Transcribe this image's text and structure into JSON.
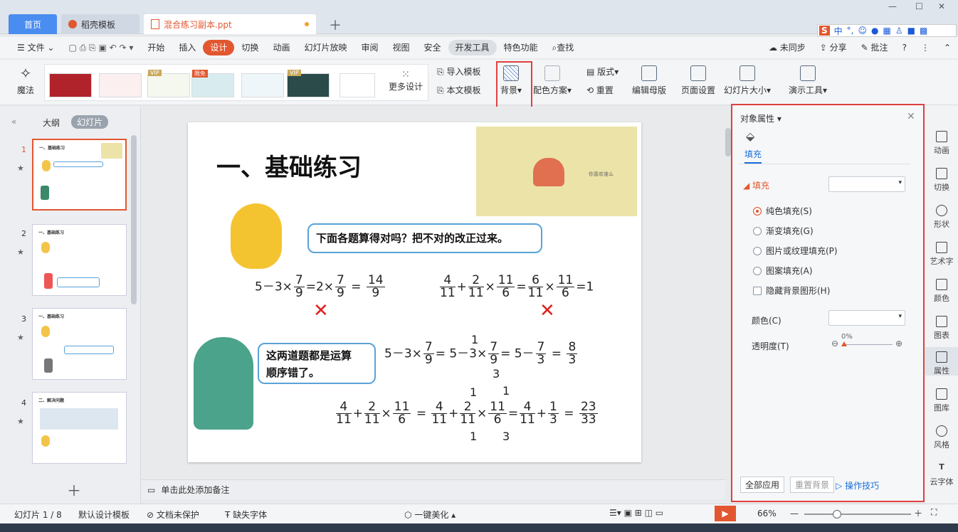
{
  "tabs": {
    "home": "首页",
    "template": "稻壳模板",
    "document": "混合练习副本.ppt"
  },
  "menu": [
    "文件",
    "开始",
    "插入",
    "设计",
    "切换",
    "动画",
    "幻灯片放映",
    "审阅",
    "视图",
    "安全",
    "开发工具",
    "特色功能",
    "查找"
  ],
  "menu_right": {
    "sync": "未同步",
    "share": "分享",
    "comment": "批注"
  },
  "ime": {
    "lang": "中"
  },
  "ribbon": {
    "magic": "魔法",
    "more_design": "更多设计",
    "import_template": "导入模板",
    "this_template": "本文模板",
    "background": "背景",
    "color_scheme": "配色方案",
    "layout": "版式",
    "reset": "重置",
    "edit_master": "编辑母版",
    "page_setup": "页面设置",
    "slide_size": "幻灯片大小",
    "presentation_tools": "演示工具"
  },
  "left_pane": {
    "outline": "大纲",
    "slides": "幻灯片",
    "numbers": [
      "1",
      "2",
      "3",
      "4"
    ],
    "thumb_titles": [
      "一、基础练习",
      "一、基础练习",
      "一、基础练习",
      "二、解决问题"
    ]
  },
  "slide": {
    "title": "一、基础练习",
    "image_caption": "你喜欢谁么",
    "bubble1": "下面各题算得对吗？把不对的改正过来。",
    "bubble2a": "这两道题都是运算",
    "bubble2b": "顺序错了。",
    "eq1": {
      "a": "5－3×",
      "f1n": "7",
      "f1d": "9",
      "b": "=2×",
      "f2n": "7",
      "f2d": "9",
      "c": "=",
      "f3n": "14",
      "f3d": "9"
    },
    "eq2": {
      "f1n": "4",
      "f1d": "11",
      "p": "+",
      "f2n": "2",
      "f2d": "11",
      "x": "×",
      "f3n": "11",
      "f3d": "6",
      "e": "=",
      "f4n": "6",
      "f4d": "11",
      "x2": "×",
      "f5n": "11",
      "f5d": "6",
      "r": "=1"
    },
    "eq3": {
      "a": "5－3×",
      "f1n": "7",
      "f1d": "9",
      "b": "= 5－3×",
      "f2n": "7",
      "f2d": "9",
      "c": "= 5－",
      "f3n": "7",
      "f3d": "3",
      "e": "=",
      "f4n": "8",
      "f4d": "3",
      "up": "1",
      "down": "3"
    },
    "eq4": {
      "f1n": "4",
      "f1d": "11",
      "p": "+",
      "f2n": "2",
      "f2d": "11",
      "x": "×",
      "f3n": "11",
      "f3d": "6",
      "e": "=",
      "f4n": "4",
      "f4d": "11",
      "p2": "+",
      "f5n": "2",
      "f5d": "11",
      "x2": "×",
      "f6n": "11",
      "f6d": "6",
      "e2": "=",
      "f7n": "4",
      "f7d": "11",
      "p3": "+",
      "f8n": "1",
      "f8d": "3",
      "e3": "=",
      "f9n": "23",
      "f9d": "33",
      "c1": "1",
      "c2": "1",
      "c3": "1",
      "c4": "3"
    }
  },
  "notes_placeholder": "单击此处添加备注",
  "panel": {
    "title": "对象属性",
    "fill_tab": "填充",
    "fill_section": "填充",
    "options": [
      "纯色填充(S)",
      "渐变填充(G)",
      "图片或纹理填充(P)",
      "图案填充(A)"
    ],
    "hide_bg": "隐藏背景图形(H)",
    "color_label": "颜色(C)",
    "transparency_label": "透明度(T)",
    "transparency_value": "0%",
    "apply_all": "全部应用",
    "reset_bg": "重置背景",
    "tips": "操作技巧"
  },
  "sidebar": [
    "动画",
    "切换",
    "形状",
    "艺术字",
    "颜色",
    "图表",
    "属性",
    "图库",
    "风格",
    "云字体"
  ],
  "status": {
    "slide_count": "幻灯片 1 / 8",
    "design_template": "默认设计模板",
    "doc_protect": "文档未保护",
    "missing_font": "缺失字体",
    "beautify": "一键美化",
    "zoom": "66%"
  },
  "colors": {
    "accent": "#e2572f",
    "highlight_box": "#e04040",
    "bubble_border": "#5aa2d8"
  }
}
